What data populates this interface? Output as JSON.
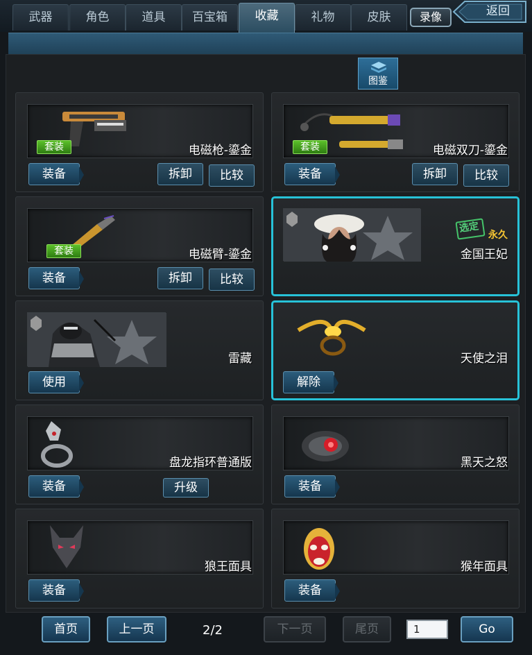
{
  "tabs": [
    {
      "label": "武器",
      "active": false
    },
    {
      "label": "角色",
      "active": false
    },
    {
      "label": "道具",
      "active": false
    },
    {
      "label": "百宝箱",
      "active": false
    },
    {
      "label": "收藏",
      "active": true
    },
    {
      "label": "礼物",
      "active": false
    },
    {
      "label": "皮肤",
      "active": false
    }
  ],
  "header": {
    "record_label": "录像",
    "back_label": "返回"
  },
  "atlas_label": "图鉴",
  "cards": [
    {
      "name": "电磁枪-鎏金",
      "suit": "套装",
      "buttons": [
        "装备",
        "拆卸",
        "比较"
      ]
    },
    {
      "name": "电磁双刀-鎏金",
      "suit": "套装",
      "buttons": [
        "装备",
        "拆卸",
        "比较"
      ]
    },
    {
      "name": "电磁臂-鎏金",
      "suit": "套装",
      "buttons": [
        "装备",
        "拆卸",
        "比较"
      ]
    },
    {
      "name": "金国王妃",
      "stamp": "选定",
      "duration": "永久"
    },
    {
      "name": "雷藏",
      "buttons": [
        "使用"
      ]
    },
    {
      "name": "天使之泪",
      "buttons": [
        "解除"
      ]
    },
    {
      "name": "盘龙指环普通版",
      "buttons": [
        "装备",
        "升级"
      ]
    },
    {
      "name": "黑天之怒",
      "buttons": [
        "装备"
      ]
    },
    {
      "name": "狼王面具",
      "buttons": [
        "装备"
      ]
    },
    {
      "name": "猴年面具",
      "buttons": [
        "装备"
      ]
    }
  ],
  "pager": {
    "first": "首页",
    "prev": "上一页",
    "status": "2/2",
    "next": "下一页",
    "last": "尾页",
    "input_value": "1",
    "go": "Go"
  },
  "colors": {
    "accent": "#27c2d8",
    "suit_green": "#4aa82a",
    "button_blue": "#2c5d7c"
  }
}
